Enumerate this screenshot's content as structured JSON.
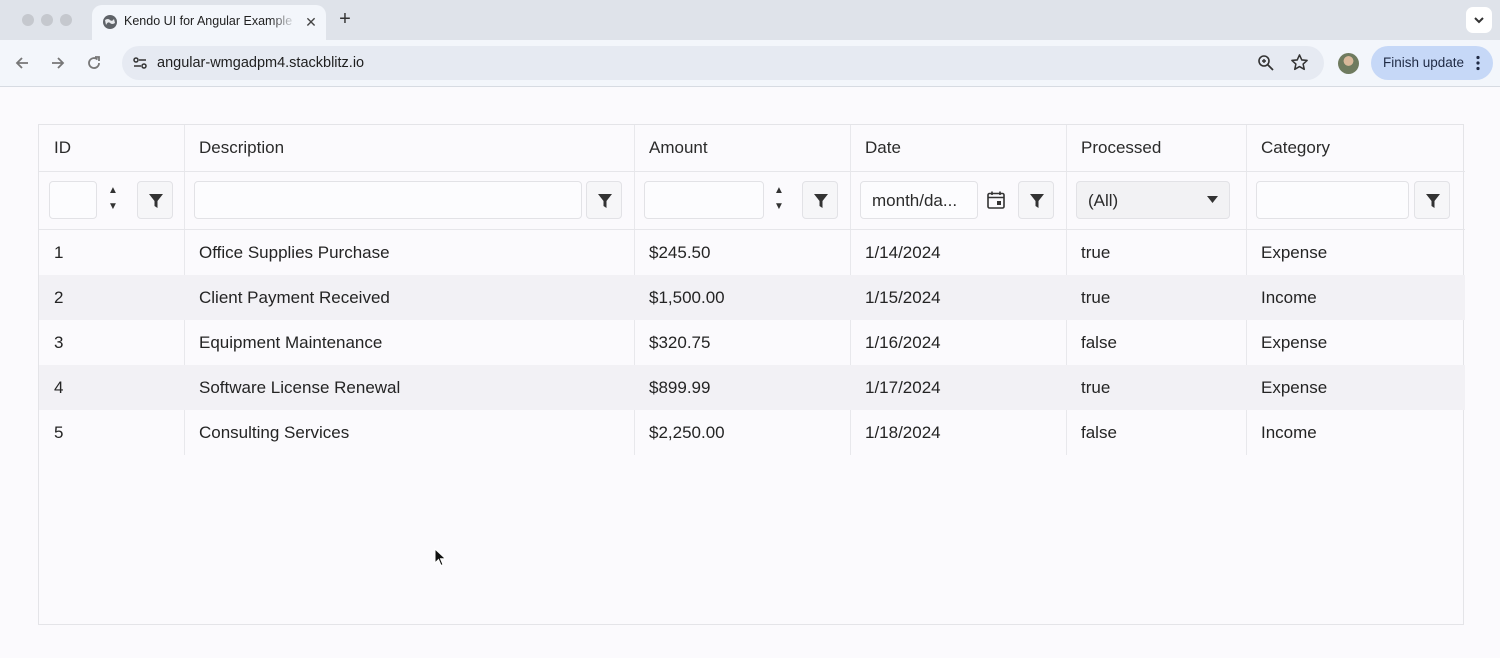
{
  "browser": {
    "tab_title": "Kendo UI for Angular Example",
    "url": "angular-wmgadpm4.stackblitz.io",
    "update_button": "Finish update",
    "icons": [
      "globe-icon",
      "close-icon",
      "plus-icon",
      "chevron-down-icon",
      "back-icon",
      "forward-icon",
      "reload-icon",
      "site-settings-icon",
      "zoom-icon",
      "star-icon",
      "kebab-icon"
    ]
  },
  "grid": {
    "columns": [
      "ID",
      "Description",
      "Amount",
      "Date",
      "Processed",
      "Category"
    ],
    "filters": {
      "date_placeholder": "month/da...",
      "processed_selected": "(All)"
    },
    "rows": [
      [
        "1",
        "Office Supplies Purchase",
        "$245.50",
        "1/14/2024",
        "true",
        "Expense"
      ],
      [
        "2",
        "Client Payment Received",
        "$1,500.00",
        "1/15/2024",
        "true",
        "Income"
      ],
      [
        "3",
        "Equipment Maintenance",
        "$320.75",
        "1/16/2024",
        "false",
        "Expense"
      ],
      [
        "4",
        "Software License Renewal",
        "$899.99",
        "1/17/2024",
        "true",
        "Expense"
      ],
      [
        "5",
        "Consulting Services",
        "$2,250.00",
        "1/18/2024",
        "false",
        "Income"
      ]
    ]
  }
}
